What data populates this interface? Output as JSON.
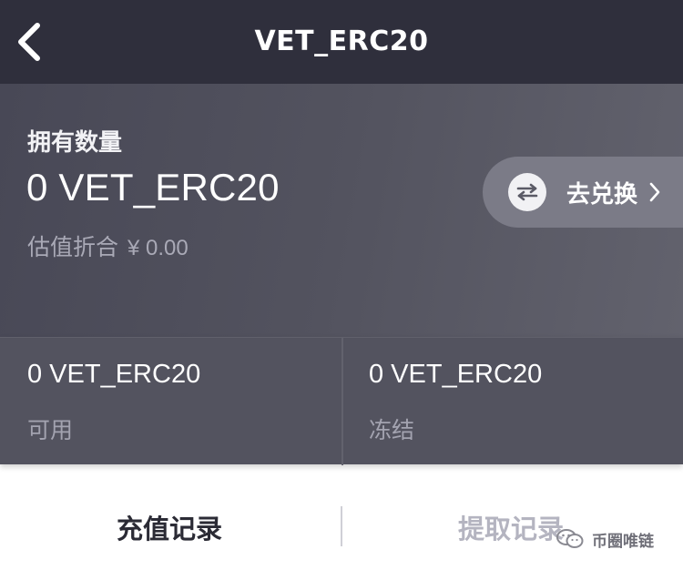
{
  "header": {
    "title": "VET_ERC20"
  },
  "balance": {
    "holdings_label": "拥有数量",
    "holdings_amount": "0 VET_ERC20",
    "valuation_label": "估值折合",
    "valuation_value": "¥ 0.00",
    "exchange_label": "去兑换"
  },
  "stats": {
    "available_amount": "0 VET_ERC20",
    "available_label": "可用",
    "frozen_amount": "0 VET_ERC20",
    "frozen_label": "冻结"
  },
  "tabs": {
    "deposit_label": "充值记录",
    "withdraw_label": "提取记录"
  },
  "watermark": {
    "text": "币圈唯链"
  },
  "colors": {
    "header_bg": "#2f2f3c",
    "card_bg": "#53535f",
    "active_tab": "#2b2b35",
    "inactive_tab": "#b4b4c0"
  },
  "icons": {
    "back": "chevron-left-icon",
    "exchange": "swap-arrows-icon",
    "exchange_chevron": "chevron-right-icon",
    "watermark": "wechat-icon"
  }
}
